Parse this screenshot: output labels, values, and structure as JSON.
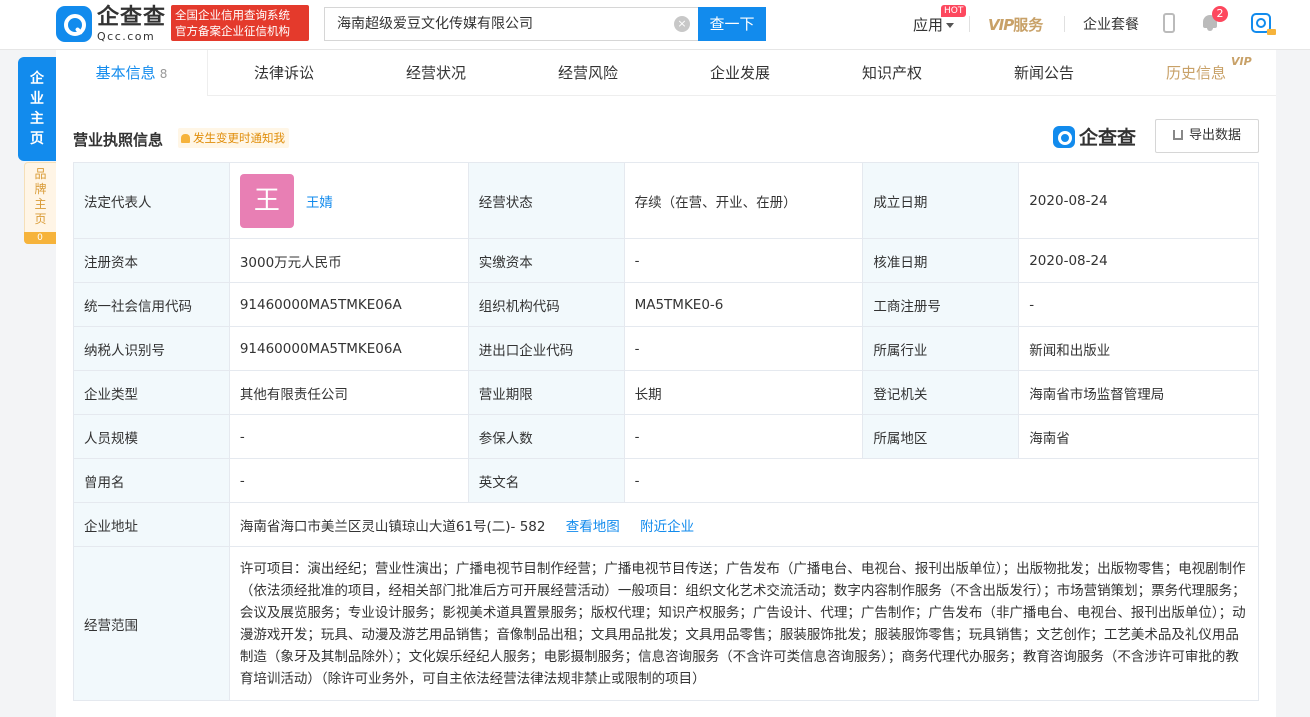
{
  "header": {
    "logo_cn": "企查查",
    "logo_en": "Qcc.com",
    "cert_line1": "全国企业信用查询系统",
    "cert_line2": "官方备案企业征信机构",
    "search_value": "海南超级爱豆文化传媒有限公司",
    "search_button": "查一下",
    "clear_icon": "×",
    "app_label": "应用",
    "hot_badge": "HOT",
    "vip_v": "VIP",
    "vip_label": "服务",
    "package_label": "企业套餐",
    "notification_count": "2"
  },
  "side": {
    "main_tab": [
      "企",
      "业",
      "主",
      "页"
    ],
    "brand_tab": [
      "品",
      "牌",
      "主",
      "页"
    ],
    "brand_count": "0"
  },
  "tabs": [
    {
      "label": "基本信息",
      "count": "8"
    },
    {
      "label": "法律诉讼"
    },
    {
      "label": "经营状况"
    },
    {
      "label": "经营风险"
    },
    {
      "label": "企业发展"
    },
    {
      "label": "知识产权"
    },
    {
      "label": "新闻公告"
    },
    {
      "label": "历史信息",
      "tag": "VIP"
    }
  ],
  "section": {
    "title": "营业执照信息",
    "notice": "发生变更时通知我",
    "brand_mark": "企查查",
    "export_label": "导出数据"
  },
  "info": {
    "legal_rep_label": "法定代表人",
    "legal_rep_avatar": "王",
    "legal_rep_name": "王婧",
    "status_label": "经营状态",
    "status_value": "存续（在营、开业、在册）",
    "founded_label": "成立日期",
    "founded_value": "2020-08-24",
    "reg_capital_label": "注册资本",
    "reg_capital_value": "3000万元人民币",
    "paid_capital_label": "实缴资本",
    "paid_capital_value": "-",
    "approved_label": "核准日期",
    "approved_value": "2020-08-24",
    "credit_code_label": "统一社会信用代码",
    "credit_code_value": "91460000MA5TMKE06A",
    "org_code_label": "组织机构代码",
    "org_code_value": "MA5TMKE0-6",
    "biz_reg_label": "工商注册号",
    "biz_reg_value": "-",
    "taxpayer_label": "纳税人识别号",
    "taxpayer_value": "91460000MA5TMKE06A",
    "import_export_label": "进出口企业代码",
    "import_export_value": "-",
    "industry_label": "所属行业",
    "industry_value": "新闻和出版业",
    "type_label": "企业类型",
    "type_value": "其他有限责任公司",
    "term_label": "营业期限",
    "term_value": "长期",
    "authority_label": "登记机关",
    "authority_value": "海南省市场监督管理局",
    "staff_label": "人员规模",
    "staff_value": "-",
    "insured_label": "参保人数",
    "insured_value": "-",
    "region_label": "所属地区",
    "region_value": "海南省",
    "former_name_label": "曾用名",
    "former_name_value": "-",
    "english_name_label": "英文名",
    "english_name_value": "-",
    "address_label": "企业地址",
    "address_value": "海南省海口市美兰区灵山镇琼山大道61号(二)- 582",
    "map_link": "查看地图",
    "nearby_link": "附近企业",
    "scope_label": "经营范围",
    "scope_value": "许可项目：演出经纪；营业性演出；广播电视节目制作经营；广播电视节目传送；广告发布（广播电台、电视台、报刊出版单位）；出版物批发；出版物零售；电视剧制作（依法须经批准的项目，经相关部门批准后方可开展经营活动）一般项目：组织文化艺术交流活动；数字内容制作服务（不含出版发行）；市场营销策划；票务代理服务；会议及展览服务；专业设计服务；影视美术道具置景服务；版权代理；知识产权服务；广告设计、代理；广告制作；广告发布（非广播电台、电视台、报刊出版单位）；动漫游戏开发；玩具、动漫及游艺用品销售；音像制品出租；文具用品批发；文具用品零售；服装服饰批发；服装服饰零售；玩具销售；文艺创作；工艺美术品及礼仪用品制造（象牙及其制品除外）；文化娱乐经纪人服务；电影摄制服务；信息咨询服务（不含许可类信息咨询服务）；商务代理代办服务；教育咨询服务（不含涉许可审批的教育培训活动）（除许可业务外，可自主依法经营法律法规非禁止或限制的项目）"
  },
  "colors": {
    "accent": "#128bed",
    "cert_red": "#e43a2c",
    "vip_gold": "#c8a168",
    "label_bg": "#f2f9fc",
    "avatar_pink": "#e87fb4"
  }
}
